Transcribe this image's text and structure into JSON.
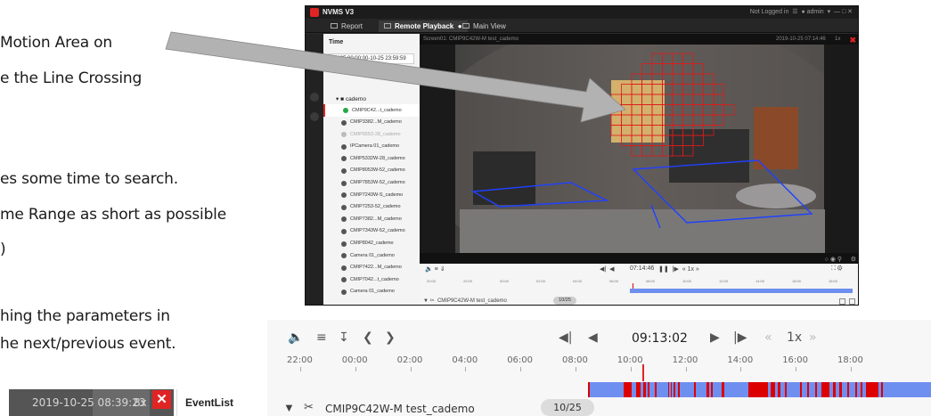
{
  "slide": {
    "lines": [
      "Motion Area on",
      "e the Line Crossing",
      "es some time to search.",
      "me Range as short as possible",
      ")",
      "hing the parameters in",
      "he next/previous event."
    ]
  },
  "nvms": {
    "title": "NVMS V3",
    "status": "Not Logged in",
    "user": "admin",
    "tabs": [
      "Report",
      "Remote Playback",
      "Main View"
    ],
    "time_label": "Time",
    "time_range": "10-25 00:00:00-10-25 23:59:59",
    "tree_root": "cademo",
    "tree_items": [
      {
        "label": "CMIP9C42...t_cademo",
        "state": "selected"
      },
      {
        "label": "CMIP3382...M_cademo",
        "state": "normal"
      },
      {
        "label": "CMIP5553-28_cademo",
        "state": "dim"
      },
      {
        "label": "IPCamera 01_cademo",
        "state": "normal"
      },
      {
        "label": "CMIP5332W-28_cademo",
        "state": "normal"
      },
      {
        "label": "CMIP8053W-52_cademo",
        "state": "normal"
      },
      {
        "label": "CMIP7853W-52_cademo",
        "state": "normal"
      },
      {
        "label": "CMIP7243W-S_cademo",
        "state": "normal"
      },
      {
        "label": "CMIP7253-52_cademo",
        "state": "normal"
      },
      {
        "label": "CMIP7382...M_cademo",
        "state": "normal"
      },
      {
        "label": "CMIP7343W-52_cademo",
        "state": "normal"
      },
      {
        "label": "CMIP8042_cademo",
        "state": "normal"
      },
      {
        "label": "Camera 01_cademo",
        "state": "normal"
      },
      {
        "label": "CMIP7422...M_cademo",
        "state": "normal"
      },
      {
        "label": "CMIP7042...t_cademo",
        "state": "normal"
      },
      {
        "label": "Camera 01_cademo",
        "state": "normal"
      }
    ],
    "video_caption": "Screen01: CMIP9C42W-M test_cademo",
    "video_time": "2019-10-25 07:14:46",
    "video_speed": "1x",
    "mini_time": "07:14:46",
    "mini_speed": "1x",
    "mini_ticks": [
      "20:00",
      "22:00",
      "00:00",
      "02:00",
      "04:00",
      "06:00",
      "08:00",
      "10:00",
      "12:00",
      "14:00",
      "16:00",
      "18:00"
    ],
    "mini_camera": "CMIP9C42W-M test_cademo",
    "mini_count": "10/25"
  },
  "zoom": {
    "time": "09:13:02",
    "speed": "1x",
    "ticks": [
      "22:00",
      "00:00",
      "02:00",
      "04:00",
      "06:00",
      "08:00",
      "10:00",
      "12:00",
      "14:00",
      "16:00",
      "18:00"
    ],
    "camera": "CMIP9C42W-M test_cademo",
    "count": "10/25",
    "colors": {
      "record": "#6f8ff0",
      "event": "#dd0000"
    }
  },
  "event_panel": {
    "time": "2019-10-25 08:39:23",
    "speed": "8x",
    "list_title": "EventList"
  }
}
